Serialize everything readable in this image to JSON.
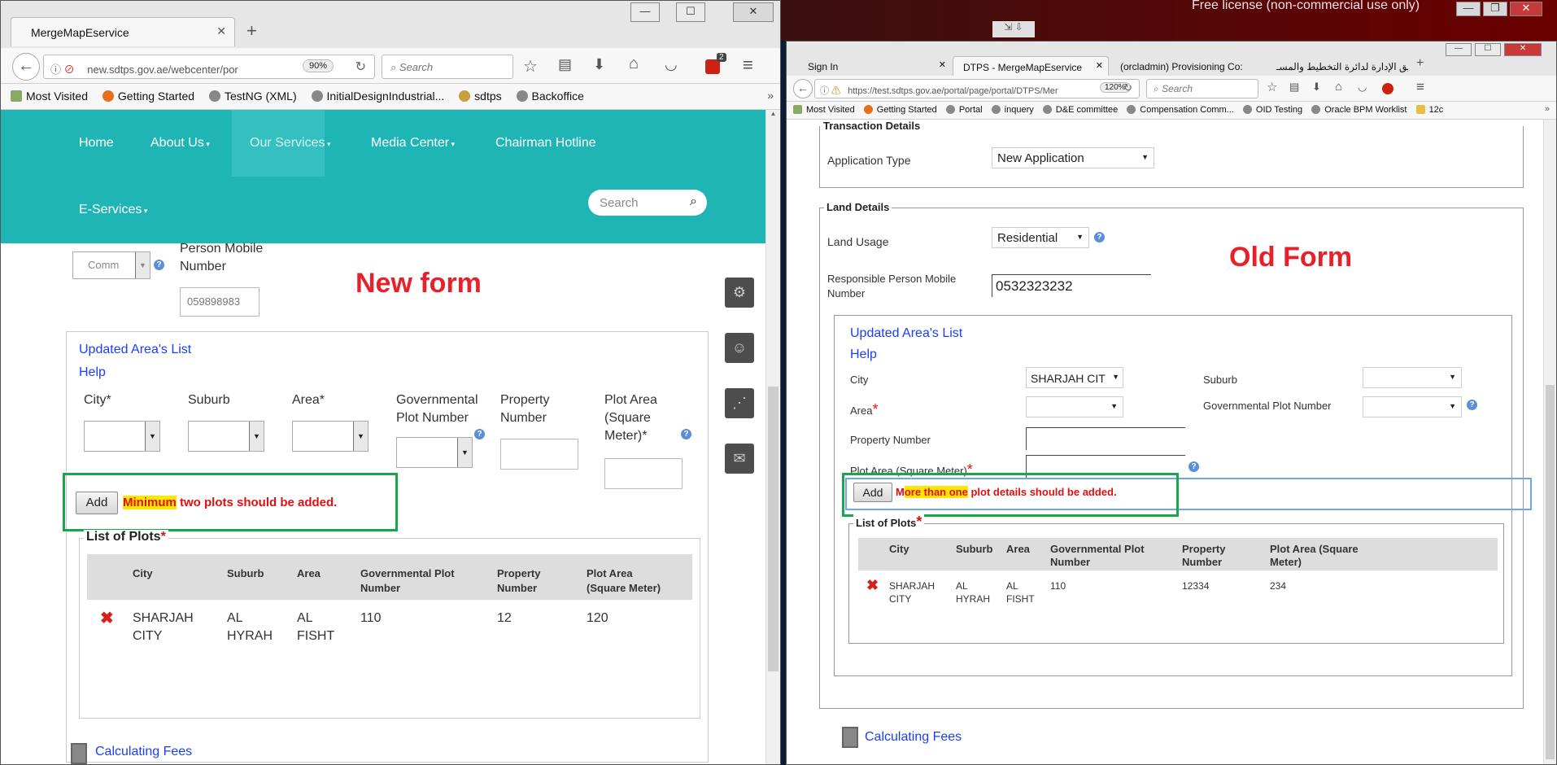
{
  "desktop": {
    "banner": "Free license (non-commercial use only)"
  },
  "left_window": {
    "tab_title": "MergeMapEservice",
    "new_tab": "+",
    "url": "new.sdtps.gov.ae/webcenter/por",
    "zoom": "90%",
    "search_placeholder": "Search",
    "badge": "2",
    "bookmarks": [
      "Most Visited",
      "Getting Started",
      "TestNG (XML)",
      "InitialDesignIndustrial...",
      "sdtps",
      "Backoffice"
    ],
    "nav": [
      "Home",
      "About Us",
      "Our Services",
      "Media Center",
      "Chairman Hotline",
      "E-Services"
    ],
    "site_search_placeholder": "Search",
    "partial_select": "Comm",
    "mobile_label_1": "Person Mobile",
    "mobile_label_2": "Number",
    "mobile_value": "059898983",
    "annotation": "New form",
    "updated_area_link": "Updated Area's List",
    "help_link": "Help",
    "col_labels": {
      "city": "City*",
      "suburb": "Suburb",
      "area": "Area*",
      "gov1": "Governmental",
      "gov2": "Plot Number",
      "prop1": "Property",
      "prop2": "Number",
      "plot1": "Plot Area",
      "plot2": "(Square",
      "plot3": "Meter)*"
    },
    "add_button": "Add",
    "msg_highlight": "Minimum",
    "msg_rest": " two plots should be added.",
    "list_title": "List of Plots",
    "list_star": "*",
    "table_headers": [
      "City",
      "Suburb",
      "Area",
      "Governmental Plot",
      "Property",
      "Plot Area"
    ],
    "table_headers_2": [
      "",
      "",
      "",
      "Number",
      "Number",
      "(Square Meter)"
    ],
    "row": {
      "city1": "SHARJAH",
      "city2": "CITY",
      "suburb1": "AL",
      "suburb2": "HYRAH",
      "area1": "AL",
      "area2": "FISHT",
      "gov": "110",
      "prop": "12",
      "plot": "120"
    },
    "calc_fees": "Calculating Fees"
  },
  "right_window": {
    "tabs": [
      "Sign In",
      "DTPS - MergeMapEservice",
      "(orcladmin) Provisioning Co:",
      "تطبيق الإدارة لدائرة التخطيط والمسـ"
    ],
    "url": "https://test.sdtps.gov.ae/portal/page/portal/DTPS/Mer",
    "zoom": "120%",
    "search_placeholder": "Search",
    "bookmarks": [
      "Most Visited",
      "Getting Started",
      "Portal",
      "inquery",
      "D&E committee",
      "Compensation Comm...",
      "OID Testing",
      "Oracle BPM Worklist",
      "12c"
    ],
    "transaction_legend": "Transaction Details",
    "application_type_label": "Application Type",
    "application_type_value": "New Application",
    "land_legend": "Land Details",
    "land_usage_label": "Land Usage",
    "land_usage_value": "Residential",
    "mobile_label_1": "Responsible Person Mobile",
    "mobile_label_2": "Number",
    "mobile_value": "0532323232",
    "annotation": "Old Form",
    "updated_area_link": "Updated Area's List",
    "help_link": "Help",
    "city_label": "City",
    "city_value": "SHARJAH CIT",
    "suburb_label": "Suburb",
    "area_label": "Area",
    "gov_label": "Governmental Plot Number",
    "property_label": "Property Number",
    "plot_area_label": "Plot Area (Square Meter)",
    "star": "*",
    "add_button": "Add",
    "msg_first": "M",
    "msg_highlight": "ore than one",
    "msg_rest": " plot details should be added.",
    "list_title": "List of Plots",
    "table_headers": [
      "City",
      "Suburb",
      "Area",
      "Governmental Plot",
      "Property",
      "Plot Area (Square"
    ],
    "table_headers_2": [
      "",
      "",
      "",
      "Number",
      "Number",
      "Meter)"
    ],
    "row": {
      "city1": "SHARJAH",
      "city2": "CITY",
      "suburb1": "AL",
      "suburb2": "HYRAH",
      "area1": "AL",
      "area2": "FISHT",
      "gov": "110",
      "prop": "12334",
      "plot": "234"
    },
    "calc_fees": "Calculating Fees"
  },
  "colors": {
    "teal": "#1fb5b5",
    "red_text": "#e01010",
    "annotation_red": "#e8202a",
    "highlight": "#ffe600",
    "green_box": "#1aa64a",
    "link_blue": "#1a3dff"
  }
}
